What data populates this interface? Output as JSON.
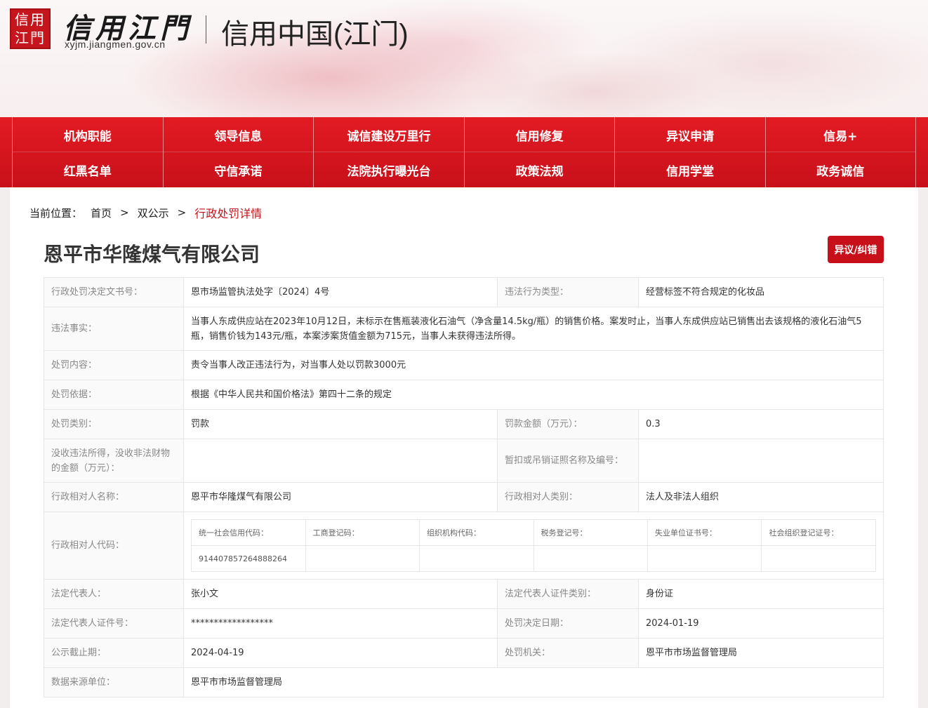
{
  "header": {
    "seal_text": "信用江門",
    "logo_text": "信用江門",
    "logo_url": "xyjm.jiangmen.gov.cn",
    "site_title": "信用中国(江门)"
  },
  "nav": {
    "row1": [
      "机构职能",
      "领导信息",
      "诚信建设万里行",
      "信用修复",
      "异议申请",
      "信易+"
    ],
    "row2": [
      "红黑名单",
      "守信承诺",
      "法院执行曝光台",
      "政策法规",
      "信用学堂",
      "政务诚信"
    ]
  },
  "breadcrumb": {
    "label": "当前位置：",
    "home": "首页",
    "sep": ">",
    "section": "双公示",
    "current": "行政处罚详情"
  },
  "company": {
    "title": "恩平市华隆煤气有限公司",
    "objection_button": "异议/纠错"
  },
  "detail": {
    "decision_no_label": "行政处罚决定文书号：",
    "decision_no": "恩市场监管执法处字〔2024〕4号",
    "violation_type_label": "违法行为类型：",
    "violation_type": "经营标签不符合规定的化妆品",
    "facts_label": "违法事实：",
    "facts": "当事人东成供应站在2023年10月12日，未标示在售瓶装液化石油气（净含量14.5kg/瓶）的销售价格。案发时止，当事人东成供应站已销售出去该规格的液化石油气5瓶，销售价钱为143元/瓶，本案涉案货值金额为715元，当事人未获得违法所得。",
    "content_label": "处罚内容：",
    "content": "责令当事人改正违法行为，对当事人处以罚款3000元",
    "basis_label": "处罚依据：",
    "basis": "根据《中华人民共和国价格法》第四十二条的规定",
    "category_label": "处罚类别：",
    "category": "罚款",
    "fine_label": "罚款金额（万元）：",
    "fine": "0.3",
    "confiscate_label": "没收违法所得，没收非法财物的金额（万元）：",
    "confiscate": "",
    "license_label": "暂扣或吊销证照名称及编号：",
    "license": "",
    "party_name_label": "行政相对人名称：",
    "party_name": "恩平市华隆煤气有限公司",
    "party_type_label": "行政相对人类别：",
    "party_type": "法人及非法人组织",
    "party_code_label": "行政相对人代码：",
    "codes": {
      "headers": [
        "统一社会信用代码：",
        "工商登记码：",
        "组织机构代码：",
        "税务登记号：",
        "失业单位证书号：",
        "社会组织登记证号："
      ],
      "values": [
        "914407857264888264",
        "",
        "",
        "",
        "",
        ""
      ]
    },
    "legal_rep_label": "法定代表人：",
    "legal_rep": "张小文",
    "legal_rep_cert_type_label": "法定代表人证件类别：",
    "legal_rep_cert_type": "身份证",
    "legal_rep_cert_no_label": "法定代表人证件号：",
    "legal_rep_cert_no": "******************",
    "decision_date_label": "处罚决定日期：",
    "decision_date": "2024-01-19",
    "publish_deadline_label": "公示截止期：",
    "publish_deadline": "2024-04-19",
    "authority_label": "处罚机关：",
    "authority": "恩平市市场监督管理局",
    "source_label": "数据来源单位：",
    "source": "恩平市市场监督管理局"
  }
}
